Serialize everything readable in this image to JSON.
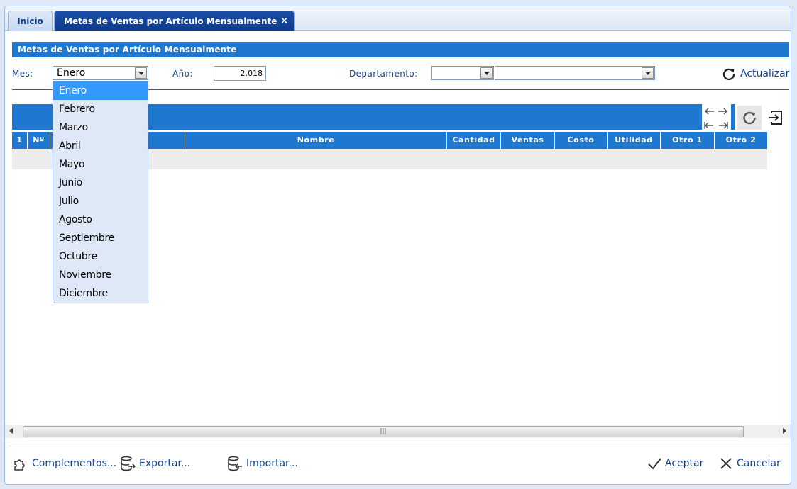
{
  "tabs": {
    "inicio": "Inicio",
    "active": "Metas de Ventas por Artículo Mensualmente",
    "close_glyph": "×"
  },
  "panel": {
    "title": "Metas de Ventas por Artículo Mensualmente"
  },
  "filters": {
    "mes_label": "Mes:",
    "mes_value": "Enero",
    "anio_label": "Año:",
    "anio_value": "2.018",
    "departamento_label": "Departamento:",
    "departamento_value": "",
    "departamento_sub_value": "",
    "actualizar_label": "Actualizar"
  },
  "month_options": [
    "Enero",
    "Febrero",
    "Marzo",
    "Abril",
    "Mayo",
    "Junio",
    "Julio",
    "Agosto",
    "Septiembre",
    "Octubre",
    "Noviembre",
    "Diciembre"
  ],
  "selected_month_index": 0,
  "grid": {
    "columns": [
      "1",
      "Nº",
      "",
      "Nombre",
      "Cantidad",
      "Ventas",
      "Costo",
      "Utilidad",
      "Otro 1",
      "Otro 2"
    ]
  },
  "toolbar_icons": [
    "expand-columns-icon",
    "collapse-columns-icon",
    "refresh-icon",
    "exit-icon"
  ],
  "footer": {
    "complementos": "Complementos...",
    "exportar": "Exportar...",
    "importar": "Importar...",
    "aceptar": "Aceptar",
    "cancelar": "Cancelar"
  },
  "colors": {
    "accent": "#1e78d0",
    "tab_active": "#0d3b8c",
    "label": "#15428b",
    "selection": "#3399ff"
  }
}
